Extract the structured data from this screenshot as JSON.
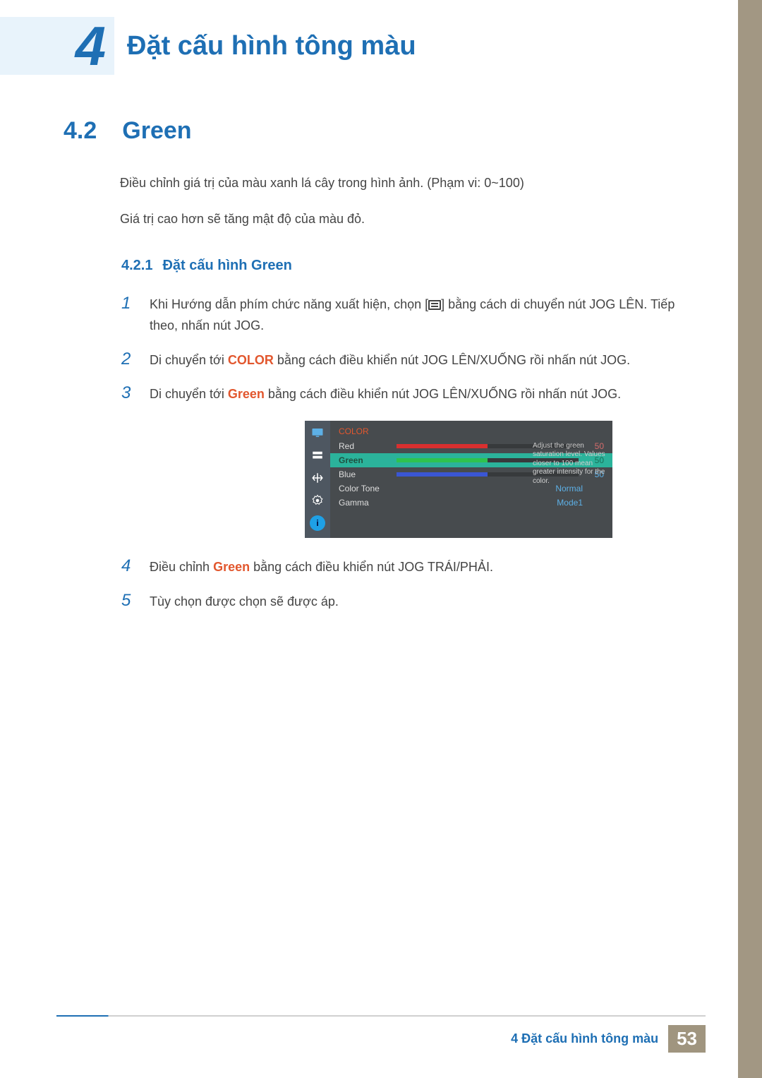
{
  "chapter": {
    "number": "4",
    "title": "Đặt cấu hình tông màu"
  },
  "section": {
    "number": "4.2",
    "title": "Green"
  },
  "intro": {
    "p1": "Điều chỉnh giá trị của màu xanh lá cây trong hình ảnh. (Phạm vi: 0~100)",
    "p2": "Giá trị cao hơn sẽ tăng mật độ của màu đỏ."
  },
  "subsection": {
    "number": "4.2.1",
    "title": "Đặt cấu hình Green"
  },
  "steps": [
    {
      "n": "1",
      "pre": "Khi Hướng dẫn phím chức năng xuất hiện, chọn [",
      "post": "] bằng cách di chuyển nút JOG LÊN. Tiếp theo, nhấn nút JOG."
    },
    {
      "n": "2",
      "pre": "Di chuyển tới ",
      "kw": "COLOR",
      "post": " bằng cách điều khiển nút JOG LÊN/XUỐNG rồi nhấn nút JOG."
    },
    {
      "n": "3",
      "pre": "Di chuyển tới ",
      "kw": "Green",
      "post": " bằng cách điều khiển nút JOG LÊN/XUỐNG rồi nhấn nút JOG."
    },
    {
      "n": "4",
      "pre": "Điều chỉnh ",
      "kw": "Green",
      "post": " bằng cách điều khiển nút JOG TRÁI/PHẢI."
    },
    {
      "n": "5",
      "text": "Tùy chọn được chọn sẽ được áp."
    }
  ],
  "osd": {
    "title": "COLOR",
    "desc": "Adjust the green saturation level. Values closer to 100 mean greater intensity for the color.",
    "rows": {
      "red": {
        "label": "Red",
        "value": "50",
        "barColor": "#d92f2f"
      },
      "green": {
        "label": "Green",
        "value": "50",
        "barColor": "#2fc24f"
      },
      "blue": {
        "label": "Blue",
        "value": "50",
        "barColor": "#3a56d4"
      },
      "tone": {
        "label": "Color Tone",
        "value": "Normal"
      },
      "gamma": {
        "label": "Gamma",
        "value": "Mode1"
      }
    }
  },
  "footer": {
    "text": "4 Đặt cấu hình tông màu",
    "page": "53"
  }
}
